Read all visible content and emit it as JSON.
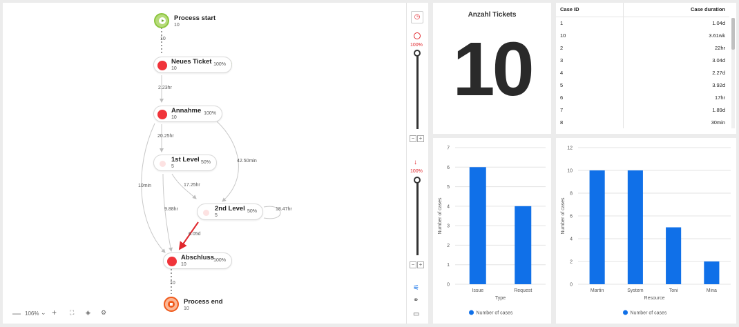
{
  "map": {
    "nodes": {
      "start": {
        "name": "Process start",
        "count": "10"
      },
      "neues_ticket": {
        "name": "Neues Ticket",
        "count": "10",
        "pct": "100%"
      },
      "annahme": {
        "name": "Annahme",
        "count": "10",
        "pct": "100%"
      },
      "first_level": {
        "name": "1st Level",
        "count": "5",
        "pct": "50%"
      },
      "second_level": {
        "name": "2nd Level",
        "count": "5",
        "pct": "50%"
      },
      "abschluss": {
        "name": "Abschluss",
        "count": "10",
        "pct": "100%"
      },
      "end": {
        "name": "Process end",
        "count": "10"
      }
    },
    "edges": {
      "start_neues": "10",
      "neues_annahme": "2.23hr",
      "annahme_first": "20.25hr",
      "annahme_second": "42.50min",
      "annahme_abschluss": "10min",
      "first_second": "17.25hr",
      "first_abschluss": "9.88hr",
      "second_loop": "18.47hr",
      "second_abschluss": "6.05d",
      "abschluss_end": "10"
    },
    "colors": {
      "activity": "#f0343a",
      "light": "#fde2e2",
      "start": "#8dc63f",
      "end": "#f05a1c",
      "edge": "#c8c8c8",
      "highlight": "#e0262c"
    },
    "zoom": "106%"
  },
  "sliders": {
    "activities_pct": "100%",
    "paths_pct": "100%"
  },
  "kpi": {
    "title": "Anzahl Tickets",
    "value": "10"
  },
  "table": {
    "headers": [
      "Case ID",
      "Case duration"
    ],
    "rows": [
      [
        "1",
        "1.04d"
      ],
      [
        "10",
        "3.61wk"
      ],
      [
        "2",
        "22hr"
      ],
      [
        "3",
        "3.04d"
      ],
      [
        "4",
        "2.27d"
      ],
      [
        "5",
        "3.92d"
      ],
      [
        "6",
        "17hr"
      ],
      [
        "7",
        "1.89d"
      ],
      [
        "8",
        "30min"
      ]
    ]
  },
  "chart_data": [
    {
      "type": "bar",
      "categories": [
        "Issue",
        "Request"
      ],
      "values": [
        6,
        4
      ],
      "xlabel": "Type",
      "ylabel": "Number of cases",
      "ylim": [
        0,
        7
      ],
      "yticks": [
        0,
        1,
        2,
        3,
        4,
        5,
        6,
        7
      ],
      "legend": "Number of cases",
      "color": "#1070e8",
      "grid": true
    },
    {
      "type": "bar",
      "categories": [
        "Martin",
        "System",
        "Toni",
        "Mina"
      ],
      "values": [
        10,
        10,
        5,
        2
      ],
      "xlabel": "Resource",
      "ylabel": "Number of cases",
      "ylim": [
        0,
        12
      ],
      "yticks": [
        0,
        2,
        4,
        6,
        8,
        10,
        12
      ],
      "legend": "Number of cases",
      "color": "#1070e8",
      "grid": true
    }
  ]
}
